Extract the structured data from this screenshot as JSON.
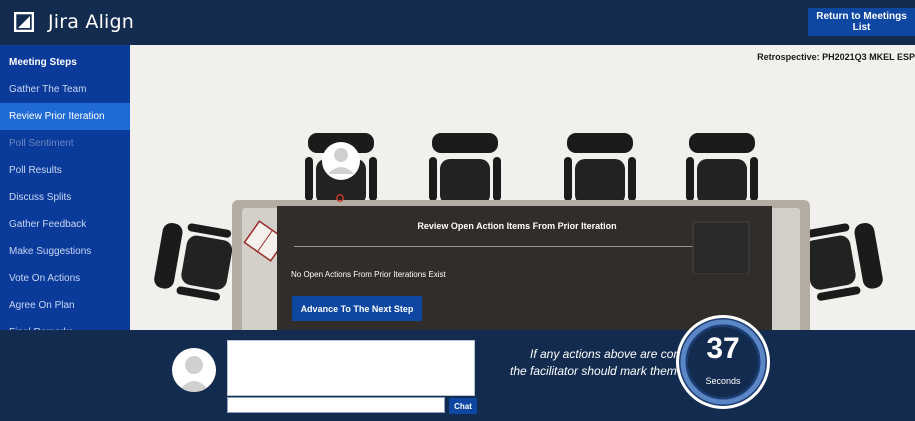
{
  "header": {
    "brand": "Jira Align",
    "return_label": "Return to Meetings List"
  },
  "sidebar": {
    "title": "Meeting Steps",
    "items": [
      {
        "label": "Gather The Team",
        "state": "normal"
      },
      {
        "label": "Review Prior Iteration",
        "state": "active"
      },
      {
        "label": "Poll Sentiment",
        "state": "disabled"
      },
      {
        "label": "Poll Results",
        "state": "normal"
      },
      {
        "label": "Discuss Splits",
        "state": "normal"
      },
      {
        "label": "Gather Feedback",
        "state": "normal"
      },
      {
        "label": "Make Suggestions",
        "state": "normal"
      },
      {
        "label": "Vote On Actions",
        "state": "normal"
      },
      {
        "label": "Agree On Plan",
        "state": "normal"
      },
      {
        "label": "Final Remarks",
        "state": "normal"
      }
    ]
  },
  "main": {
    "retro_title": "Retrospective: PH2021Q3 MKEL ESP"
  },
  "dialog": {
    "title": "Review Open Action Items From Prior Iteration",
    "message": "No Open Actions From Prior Iterations Exist",
    "button_label": "Advance To The Next Step"
  },
  "chat": {
    "input_value": "",
    "button_label": "Chat"
  },
  "notice": {
    "line1": "If any actions above are con",
    "line2": "the facilitator should mark them"
  },
  "timer": {
    "value": "37",
    "unit": "Seconds"
  },
  "colors": {
    "header_bg": "#132b4f",
    "sidebar_bg": "#0a3a9a",
    "sidebar_active": "#1f6ad4",
    "button_blue": "#0d47a1",
    "dialog_bg": "#312d2a",
    "room_bg": "#f2f0ec"
  }
}
